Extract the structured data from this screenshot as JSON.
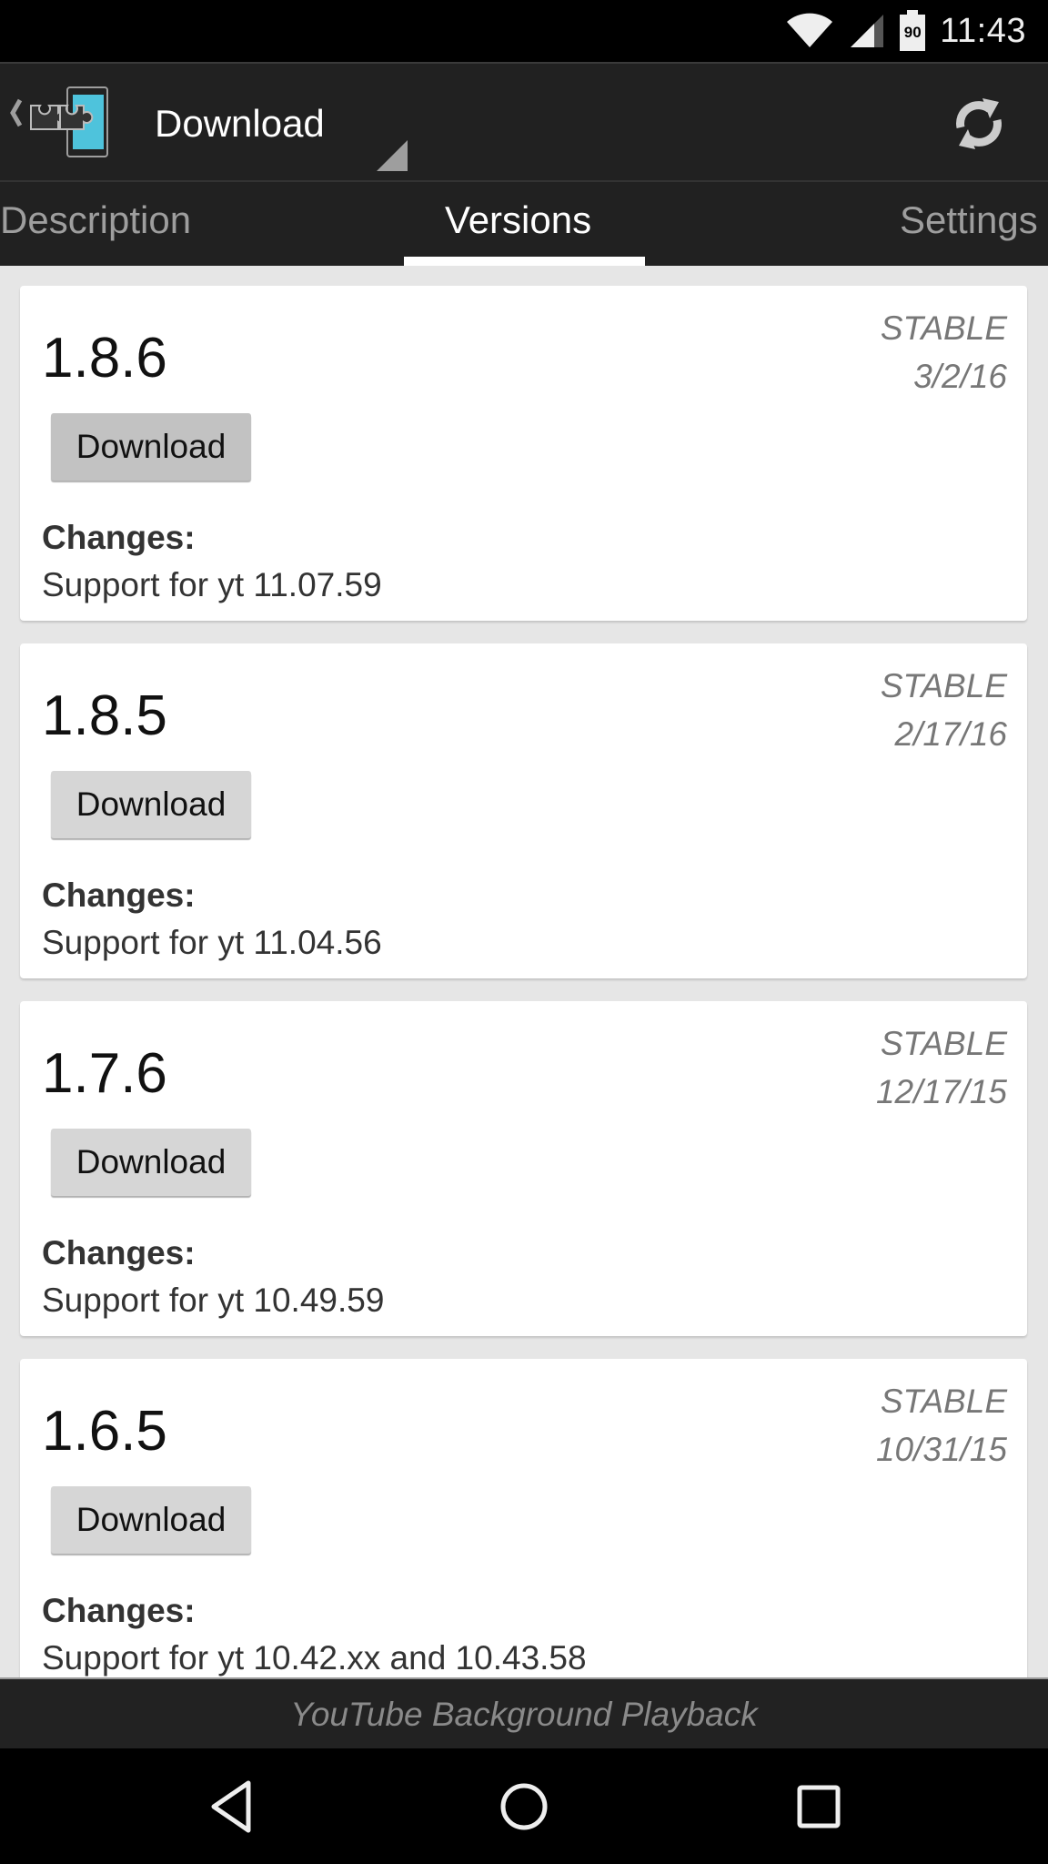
{
  "status_bar": {
    "time": "11:43",
    "battery_level": "90",
    "icons": [
      "wifi-icon",
      "cell-signal-icon",
      "battery-icon"
    ]
  },
  "action_bar": {
    "title": "Download",
    "logo": "xposed-installer-logo",
    "refresh_icon": "refresh-icon",
    "spinner_icon": "dropdown-triangle-icon"
  },
  "tabs": [
    {
      "label": "Description",
      "active": false
    },
    {
      "label": "Versions",
      "active": true
    },
    {
      "label": "Settings",
      "active": false
    }
  ],
  "versions": [
    {
      "version": "1.8.6",
      "branch": "STABLE",
      "date": "3/2/16",
      "button_label": "Download",
      "changes_label": "Changes:",
      "changes": "Support for yt 11.07.59"
    },
    {
      "version": "1.8.5",
      "branch": "STABLE",
      "date": "2/17/16",
      "button_label": "Download",
      "changes_label": "Changes:",
      "changes": "Support for yt 11.04.56"
    },
    {
      "version": "1.7.6",
      "branch": "STABLE",
      "date": "12/17/15",
      "button_label": "Download",
      "changes_label": "Changes:",
      "changes": "Support for yt 10.49.59"
    },
    {
      "version": "1.6.5",
      "branch": "STABLE",
      "date": "10/31/15",
      "button_label": "Download",
      "changes_label": "Changes:",
      "changes": "Support for yt 10.42.xx and 10.43.58"
    }
  ],
  "footer": {
    "module_name": "YouTube Background Playback"
  },
  "nav_bar": {
    "buttons": [
      "back-icon",
      "home-icon",
      "recents-icon"
    ]
  },
  "colors": {
    "logo_accent": "#4ec3dc",
    "toolbar_bg": "#212121",
    "content_bg": "#e6e6e6",
    "button_bg": "#d6d6d6"
  }
}
